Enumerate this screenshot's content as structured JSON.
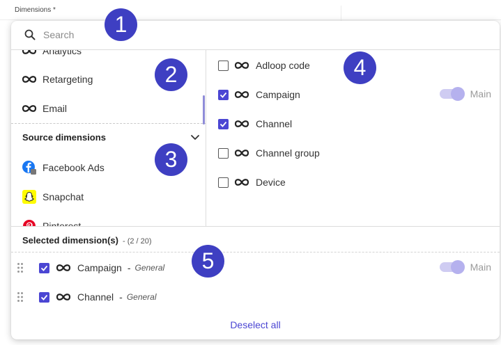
{
  "field": {
    "label": "Dimensions *"
  },
  "search": {
    "placeholder": "Search",
    "value": ""
  },
  "left_list": {
    "items": [
      {
        "label": "Analytics",
        "icon": "infinity-icon"
      },
      {
        "label": "Retargeting",
        "icon": "infinity-icon"
      },
      {
        "label": "Email",
        "icon": "infinity-icon"
      }
    ],
    "section": {
      "title": "Source dimensions",
      "icon": "chevron-down-icon"
    },
    "sources": [
      {
        "label": "Facebook Ads",
        "icon": "facebook-icon"
      },
      {
        "label": "Snapchat",
        "icon": "snapchat-icon"
      },
      {
        "label": "Pinterest",
        "icon": "pinterest-icon"
      }
    ]
  },
  "dimensions": [
    {
      "label": "Adloop code",
      "checked": false
    },
    {
      "label": "Campaign",
      "checked": true,
      "toggle_label": "Main"
    },
    {
      "label": "Channel",
      "checked": true
    },
    {
      "label": "Channel group",
      "checked": false
    },
    {
      "label": "Device",
      "checked": false
    }
  ],
  "selected": {
    "title": "Selected dimension(s)",
    "count": "- (2 / 20)",
    "items": [
      {
        "label": "Campaign",
        "dash": "-",
        "group": "General",
        "toggle_label": "Main"
      },
      {
        "label": "Channel",
        "dash": "-",
        "group": "General"
      }
    ],
    "deselect_label": "Deselect all"
  },
  "badges": [
    "1",
    "2",
    "3",
    "4",
    "5"
  ],
  "colors": {
    "accent": "#4b46d3",
    "badge": "#3e3fc2",
    "toggle_track": "#cfccf2",
    "toggle_knob": "#b5b1ee"
  }
}
